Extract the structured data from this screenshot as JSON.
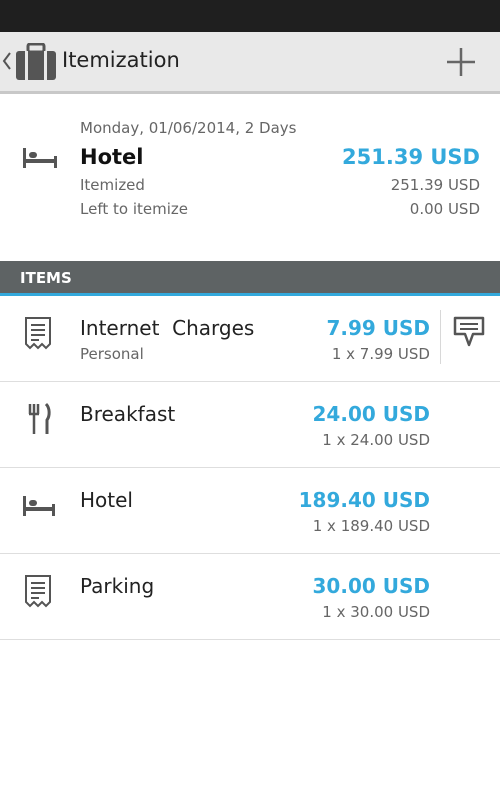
{
  "action_bar": {
    "title": "Itemization",
    "back_icon": "chevron-left-icon",
    "app_icon": "briefcase-icon",
    "add_icon": "plus-icon"
  },
  "summary": {
    "icon": "bed-icon",
    "date": "Monday, 01/06/2014, 2 Days",
    "title": "Hotel",
    "total": "251.39 USD",
    "itemized_label": "Itemized",
    "itemized_value": "251.39 USD",
    "left_label": "Left to itemize",
    "left_value": "0.00 USD"
  },
  "section": {
    "header": "ITEMS"
  },
  "colors": {
    "accent": "#33a9dc",
    "section_bg": "#5e6364",
    "action_bar_bg": "#e9e9e9"
  },
  "items": [
    {
      "name": "Internet  Charges",
      "sub": "Personal",
      "amount": "7.99 USD",
      "qty": "1 x 7.99 USD",
      "icon": "receipt-icon",
      "action_icon": "comment-icon"
    },
    {
      "name": "Breakfast",
      "sub": "",
      "amount": "24.00 USD",
      "qty": "1 x 24.00 USD",
      "icon": "fork-knife-icon"
    },
    {
      "name": "Hotel",
      "sub": "",
      "amount": "189.40 USD",
      "qty": "1 x 189.40 USD",
      "icon": "bed-icon"
    },
    {
      "name": "Parking",
      "sub": "",
      "amount": "30.00 USD",
      "qty": "1 x 30.00 USD",
      "icon": "receipt-icon"
    }
  ]
}
